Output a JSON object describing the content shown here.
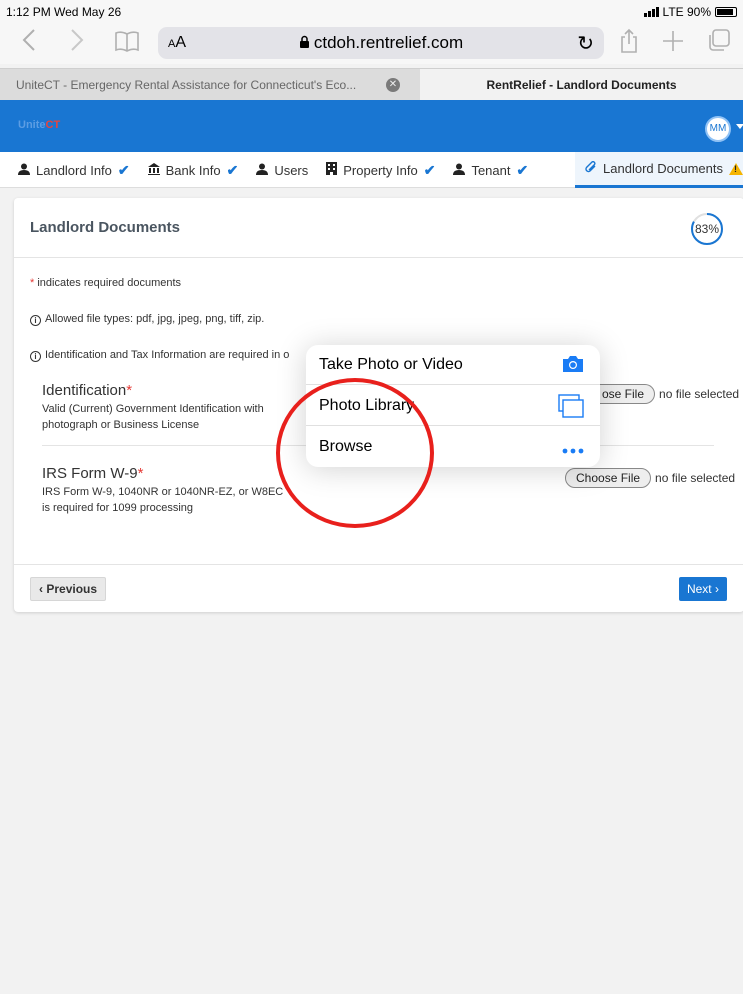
{
  "status_bar": {
    "time": "1:12 PM  Wed May 26",
    "carrier": "LTE 90%",
    "battery_level": 0.9
  },
  "browser": {
    "url": "ctdoh.rentrelief.com",
    "text_size_label": "AA",
    "icons": [
      "back-icon",
      "forward-icon",
      "bookmarks-icon",
      "lock-icon",
      "reload-icon",
      "share-icon",
      "new-tab-icon",
      "tabs-icon"
    ]
  },
  "tabs": [
    {
      "title": "UniteCT - Emergency Rental Assistance for Connecticut's Eco..."
    },
    {
      "title": "RentRelief - Landlord Documents"
    }
  ],
  "app": {
    "logo_prefix": "Unite",
    "logo_suffix": "CT",
    "avatar_initials": "MM",
    "colors": {
      "primary": "#1976d2",
      "required": "#e53935",
      "warning": "#f5b400"
    }
  },
  "steps": [
    {
      "label": "Landlord Info",
      "icon": "user-icon",
      "complete": true
    },
    {
      "label": "Bank Info",
      "icon": "bank-icon",
      "complete": true
    },
    {
      "label": "Users",
      "icon": "user-icon",
      "complete": false
    },
    {
      "label": "Property Info",
      "icon": "building-icon",
      "complete": true
    },
    {
      "label": "Tenant",
      "icon": "user-icon",
      "complete": true
    },
    {
      "label": "Landlord Documents",
      "icon": "paperclip-icon",
      "complete": false,
      "warning": true
    }
  ],
  "card": {
    "title": "Landlord Documents",
    "progress_percent": 83,
    "progress_label": "83%",
    "required_marker": "*",
    "required_note": "indicates required documents",
    "file_types_note": "Allowed file types: pdf, jpg, jpeg, png, tiff, zip.",
    "id_tax_note": "Identification and Tax Information are required in o",
    "documents": [
      {
        "title": "Identification",
        "desc_line1": "Valid (Current) Government Identification with",
        "desc_line2": "photograph or Business License",
        "choose_label": "Choose File",
        "choose_visible": "ose File",
        "status": "no file selected"
      },
      {
        "title": "IRS Form W-9",
        "desc_line1": "IRS Form W-9, 1040NR or 1040NR-EZ, or W8EC",
        "desc_line2": "is required for 1099 processing",
        "choose_label": "Choose File",
        "status": "no file selected"
      }
    ],
    "prev_label": "Previous",
    "next_label": "Next"
  },
  "popover": {
    "items": [
      {
        "label": "Take Photo or Video",
        "icon": "camera-icon"
      },
      {
        "label": "Photo Library",
        "icon": "photo-library-icon"
      },
      {
        "label": "Browse",
        "icon": "more-icon"
      }
    ]
  }
}
